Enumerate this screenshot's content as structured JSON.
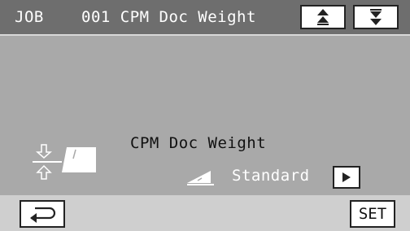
{
  "header": {
    "section": "JOB",
    "title": "001 CPM Doc Weight",
    "scroll_up_icon": "up-arrows-icon",
    "scroll_down_icon": "down-arrows-icon"
  },
  "main": {
    "setting_label": "CPM Doc Weight",
    "current_value": "Standard",
    "doc_icon": "document-weight-icon",
    "value_icon": "paper-wedge-icon",
    "next_icon": "play-right-icon"
  },
  "footer": {
    "back_icon": "return-arrow-icon",
    "set_label": "SET"
  },
  "colors": {
    "header_bg": "#6e6e6e",
    "main_bg": "#a9a9a9",
    "footer_bg": "#cfcfcf",
    "button_bg": "#ffffff"
  }
}
